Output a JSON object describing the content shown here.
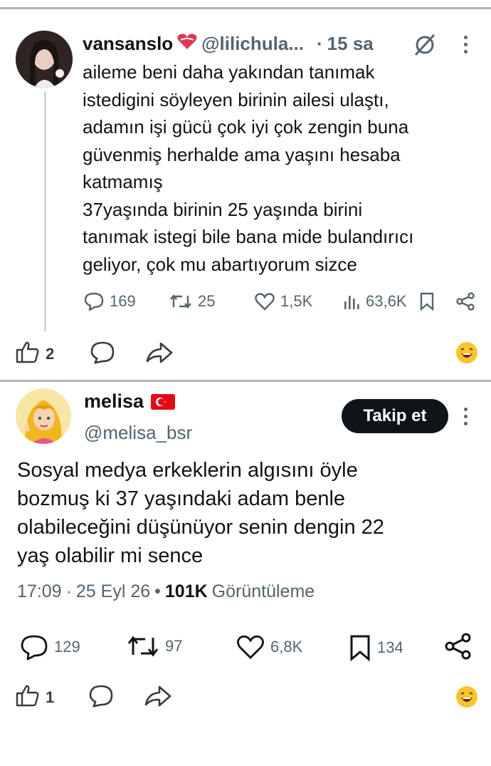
{
  "tweet1": {
    "display_name": "vansanslo",
    "handle": "@lilichula...",
    "separator": "·",
    "time": "15 sa",
    "text": "aileme beni daha yakından tanımak\nistedigini söyleyen birinin ailesi ulaştı,\nadamın işi gücü çok iyi çok zengin buna\ngüvenmiş herhalde ama yaşını hesaba\nkatmamış\n37yaşında birinin 25 yaşında birini\ntanımak istegi bile bana mide bulandırıcı\ngeliyor, çok mu abartıyorum sizce",
    "replies": "169",
    "reposts": "25",
    "likes": "1,5K",
    "views": "63,6K",
    "reactions_count": "2"
  },
  "tweet2": {
    "display_name": "melisa",
    "handle": "@melisa_bsr",
    "follow_label": "Takip et",
    "text": "Sosyal medya erkeklerin algısını öyle\nbozmuş ki 37 yaşındaki adam benle\nolabileceğini düşünüyor senin dengin 22\nyaş olabilir mi sence",
    "time": "17:09",
    "dot": "·",
    "date": "25 Eyl 26",
    "bullet": "•",
    "views_count": "101K",
    "views_label": "Görüntüleme",
    "replies": "129",
    "reposts": "97",
    "likes": "6,8K",
    "bookmarks": "134",
    "reactions_count": "1"
  },
  "colors": {
    "text": "#0f1419",
    "secondary": "#536471",
    "follow_button": "#0f1419",
    "emoji": "#f7c52b",
    "flag": "#e30a17"
  }
}
